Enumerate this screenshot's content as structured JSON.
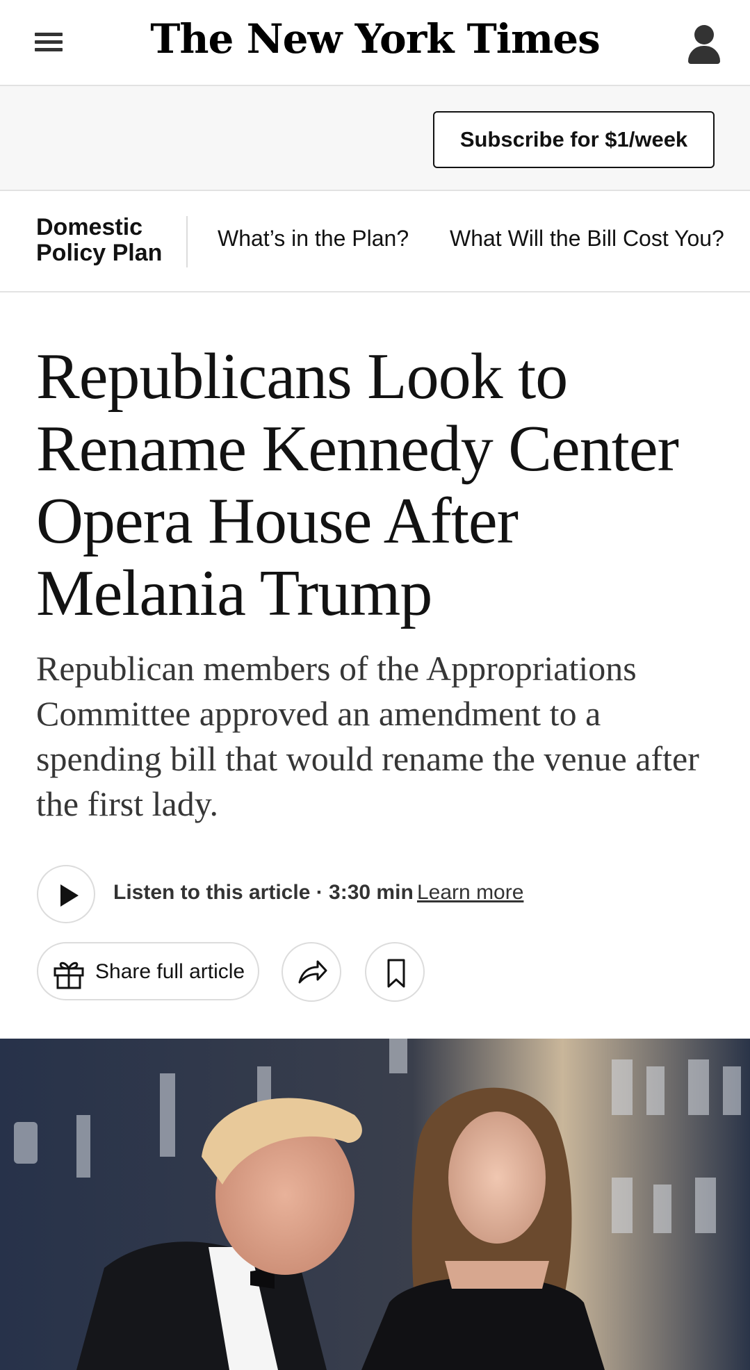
{
  "header": {
    "logo_text": "The New York Times",
    "menu_icon": "hamburger-menu-icon",
    "account_icon": "account-icon"
  },
  "subscribe": {
    "label": "Subscribe for $1/week"
  },
  "section_nav": {
    "title": "Domestic Policy Plan",
    "links": [
      {
        "label": "What’s in the Plan?"
      },
      {
        "label": "What Will the Bill Cost You?"
      }
    ]
  },
  "article": {
    "headline": "Republicans Look to Rename Kennedy Center Opera House After Melania Trump",
    "summary": "Republican members of the Appropriations Committee approved an amendment to a spending bill that would rename the venue after the first lady."
  },
  "listen": {
    "text": "Listen to this article · 3:30 min",
    "learn_more": "Learn more",
    "icon": "play-icon"
  },
  "actions": {
    "share_label": "Share full article",
    "share_icon": "gift-icon",
    "forward_icon": "share-arrow-icon",
    "save_icon": "bookmark-icon"
  },
  "colors": {
    "text": "#121212",
    "band_background": "#f7f7f7",
    "border": "#e2e2e2"
  }
}
